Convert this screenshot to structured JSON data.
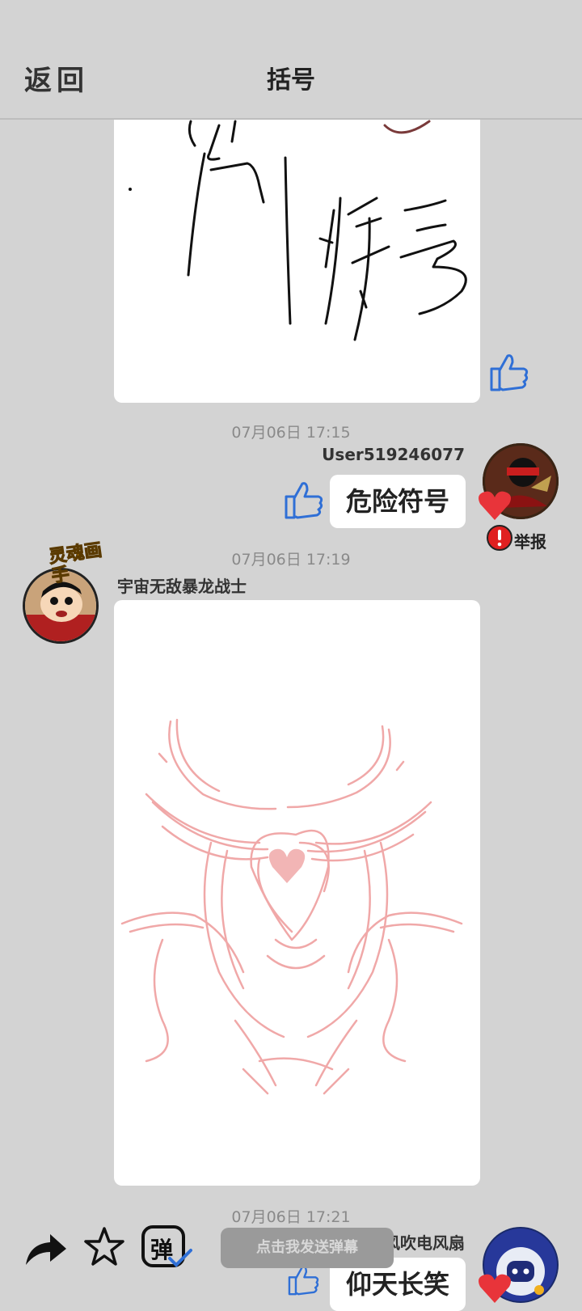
{
  "header": {
    "back_label": "返回",
    "title": "括号"
  },
  "messages": [
    {
      "timestamp": "07月06日  17:15",
      "username": "User519246077",
      "text": "危险符号",
      "report_label": "举报"
    },
    {
      "timestamp": "07月06日  17:19",
      "username": "宇宙无敌暴龙战士",
      "badge_text": "灵魂画手"
    },
    {
      "timestamp": "07月06日  17:21",
      "username": "风吹电风扇",
      "text": "仰天长笑"
    }
  ],
  "toolbar": {
    "danmaku_placeholder": "点击我发送弹幕",
    "danmaku_icon_text": "弹"
  },
  "colors": {
    "background": "#d3d3d3",
    "like_blue": "#2f6fd6",
    "heart_red": "#e8343a",
    "sketch_pink": "#f0a8a8"
  }
}
